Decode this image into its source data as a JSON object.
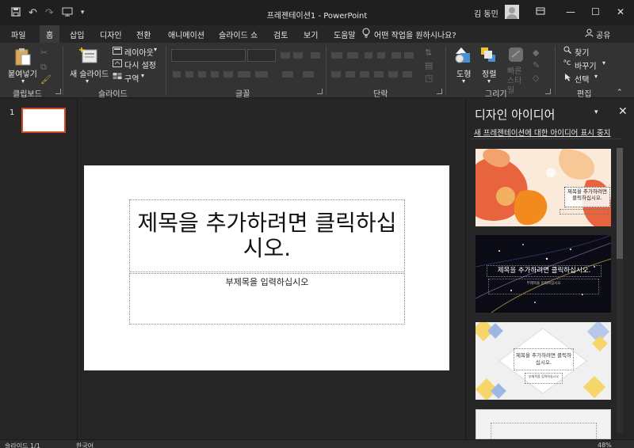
{
  "window": {
    "title": "프레젠테이션1 - PowerPoint",
    "user": "김 동민"
  },
  "tabs": [
    "파일",
    "홈",
    "삽입",
    "디자인",
    "전환",
    "애니메이션",
    "슬라이드 쇼",
    "검토",
    "보기",
    "도움말"
  ],
  "active_tab": "홈",
  "tell_me": "어떤 작업을 원하시나요?",
  "share": "공유",
  "ribbon": {
    "clipboard": {
      "paste": "붙여넣기",
      "label": "클립보드"
    },
    "slides": {
      "new_slide": "새 슬라이드",
      "layout": "레이아웃",
      "reset": "다시 설정",
      "section": "구역",
      "label": "슬라이드"
    },
    "font": {
      "label": "글꼴"
    },
    "paragraph": {
      "label": "단락"
    },
    "drawing": {
      "shapes": "도형",
      "arrange": "정렬",
      "quick_styles": "빠른 스타일",
      "label": "그리기"
    },
    "editing": {
      "find": "찾기",
      "replace": "바꾸기",
      "select": "선택",
      "label": "편집"
    }
  },
  "thumbnails": {
    "slide_number": "1"
  },
  "slide": {
    "title": "제목을 추가하려면 클릭하십시오.",
    "subtitle": "부제목을 입력하십시오"
  },
  "design_pane": {
    "title": "디자인 아이디어",
    "link": "새 프레젠테이션에 대한 아이디어 표시 중지",
    "card1_title": "제목을 추가하려면 클릭하십시오.",
    "card2_title": "제목을 추가하려면 클릭하십시오.",
    "card2_sub": "부제목을 입력하십시오",
    "card3_title": "제목을 추가하려면 클릭하십시오.",
    "card3_sub": "부제목을 입력하십시오"
  },
  "status": {
    "slide": "슬라이드 1/1",
    "lang": "한국어",
    "zoom": "48%"
  },
  "colors": {
    "accent": "#d24726",
    "ribbon_bg": "#333333",
    "pane_bg": "#262626"
  }
}
